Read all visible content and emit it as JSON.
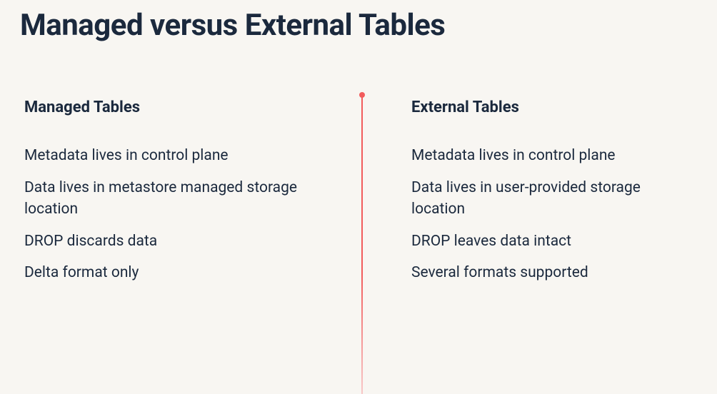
{
  "title": "Managed versus External Tables",
  "left": {
    "heading": "Managed Tables",
    "items": [
      "Metadata lives in control plane",
      "Data lives in metastore managed storage location",
      "DROP discards data",
      "Delta format only"
    ]
  },
  "right": {
    "heading": "External Tables",
    "items": [
      "Metadata lives in control plane",
      "Data lives in user-provided storage location",
      "DROP leaves data intact",
      "Several formats supported"
    ]
  }
}
